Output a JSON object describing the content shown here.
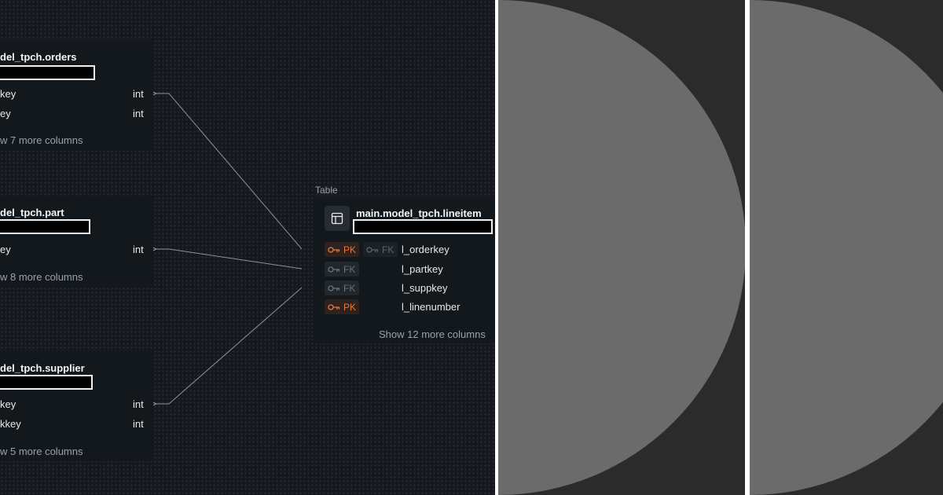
{
  "orders_table": {
    "title": "del_tpch.orders",
    "columns": [
      {
        "name": "key",
        "type": "int"
      },
      {
        "name": "ey",
        "type": "int"
      }
    ],
    "more": "w 7 more columns"
  },
  "part_table": {
    "title": "del_tpch.part",
    "columns": [
      {
        "name": "ey",
        "type": "int"
      }
    ],
    "more": "w 8 more columns"
  },
  "supplier_table": {
    "title": "del_tpch.supplier",
    "columns": [
      {
        "name": "key",
        "type": "int"
      },
      {
        "name": "kkey",
        "type": "int"
      }
    ],
    "more": "w 5 more columns"
  },
  "lineitem_table": {
    "caption": "Table",
    "title": "main.model_tpch.lineitem",
    "columns": [
      {
        "name": "l_orderkey",
        "badges": [
          "PK",
          "FK"
        ]
      },
      {
        "name": "l_partkey",
        "badges": [
          "FK"
        ]
      },
      {
        "name": "l_suppkey",
        "badges": [
          "FK"
        ]
      },
      {
        "name": "l_linenumber",
        "badges": [
          "PK"
        ]
      }
    ],
    "more": "Show 12 more columns"
  },
  "colors": {
    "canvas_bg": "#15191d",
    "card_bg": "#13181c",
    "pk": "#e8783e",
    "fk": "#6b7380",
    "edge": "#8a939c",
    "panel_bg": "#2b2b2b",
    "circle": "#6b6b6b"
  },
  "icons": [
    "table-icon",
    "key-icon"
  ]
}
